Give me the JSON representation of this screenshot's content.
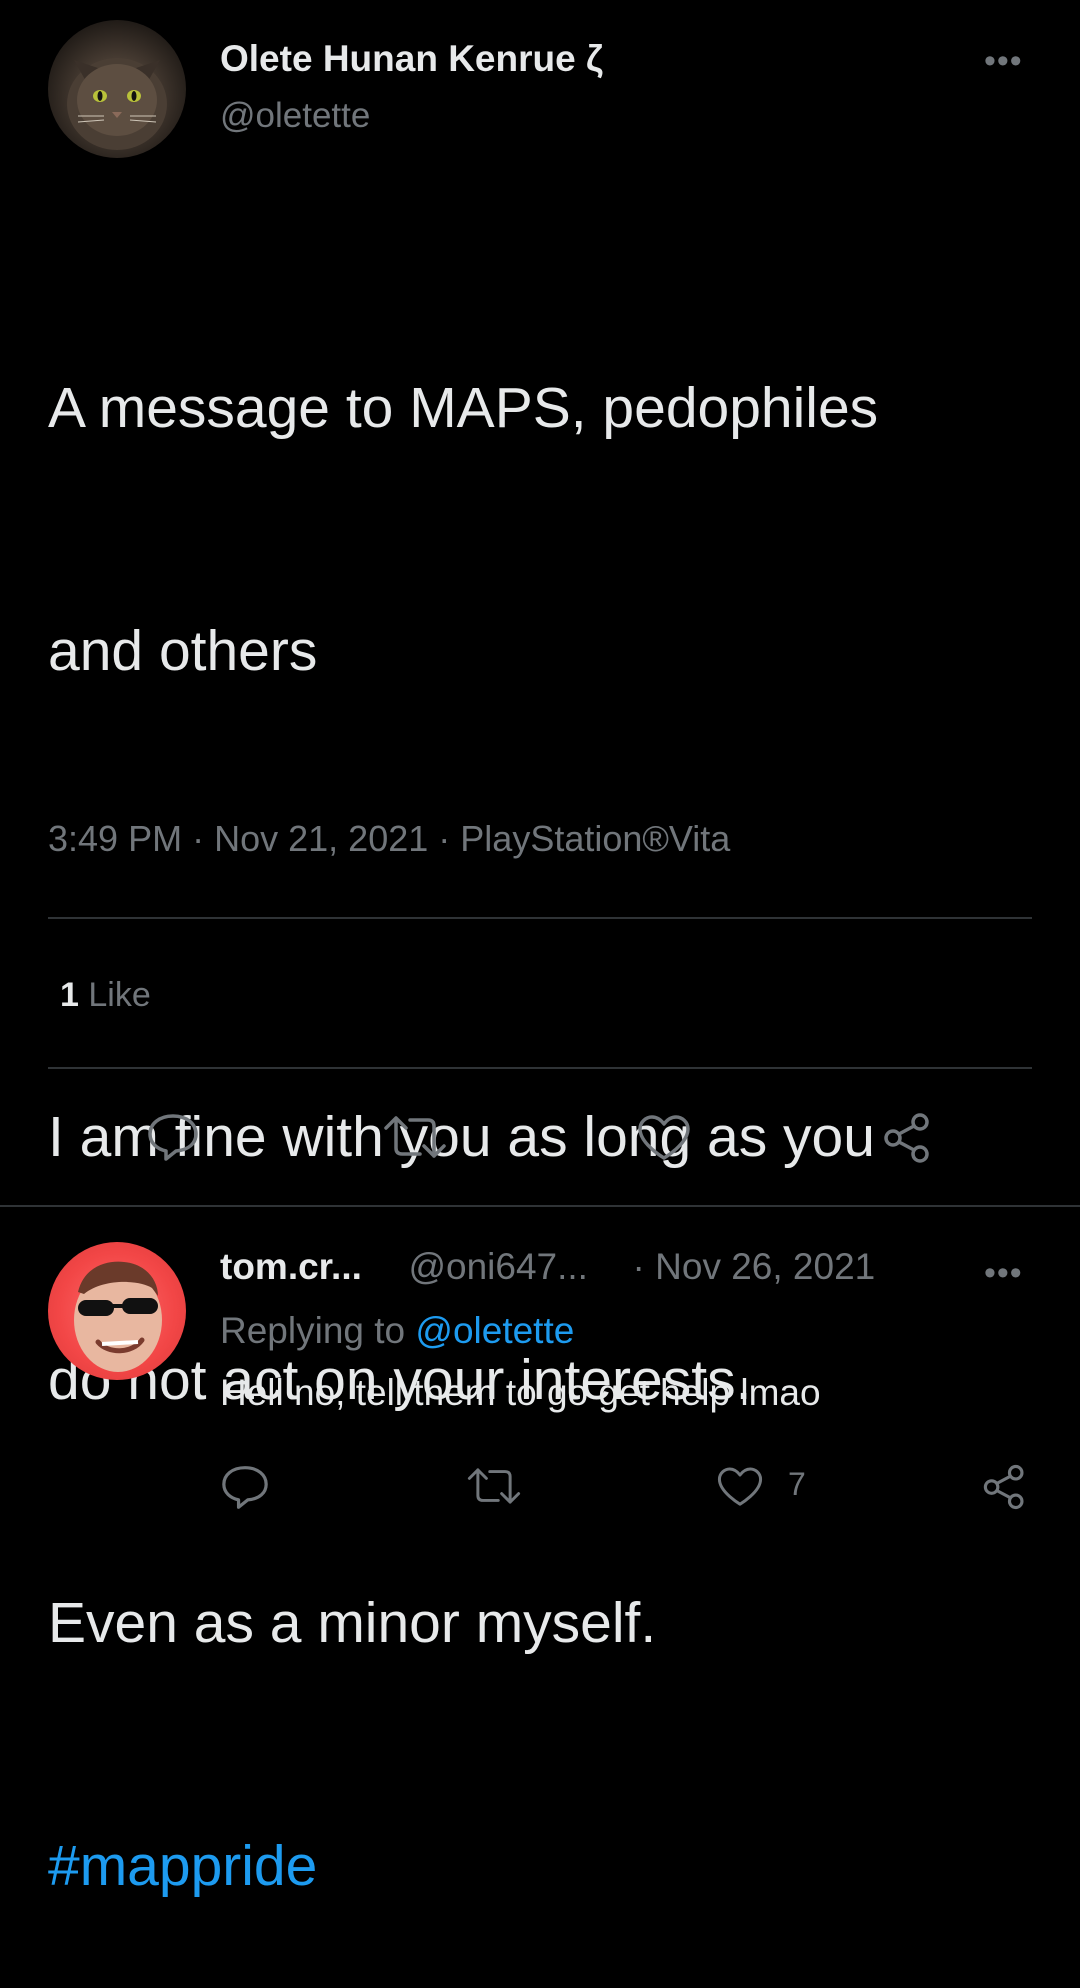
{
  "main_tweet": {
    "display_name": "Olete Hunan Kenrue ζ",
    "handle": "@oletette",
    "text_line1": "A message to MAPS, pedophiles",
    "text_line2": "and others",
    "text_line3": "I am fine with you as long as you",
    "text_line4": "do not act on your interests.",
    "text_line5": "Even as a minor myself.",
    "hashtag": "#mappride",
    "time": "3:49 PM",
    "date": "Nov 21, 2021",
    "source": "PlayStation®Vita",
    "separator": "·",
    "likes_count": "1",
    "likes_label": "Like",
    "more_label": "•••"
  },
  "reply": {
    "display_name": "tom.cr...",
    "handle": "@oni647...",
    "separator": "·",
    "date": "Nov 26, 2021",
    "replying_prefix": "Replying to",
    "replying_mention": "@oletette",
    "text": "Hell no, tell them to go get help lmao",
    "like_count": "7",
    "more_label": "•••"
  },
  "icons": {
    "reply": "reply-icon",
    "retweet": "retweet-icon",
    "like": "heart-icon",
    "share": "share-icon"
  },
  "colors": {
    "background": "#000000",
    "text": "#e7e9ea",
    "secondary": "#71767b",
    "link": "#1d9bf0",
    "divider": "#2f3336"
  }
}
